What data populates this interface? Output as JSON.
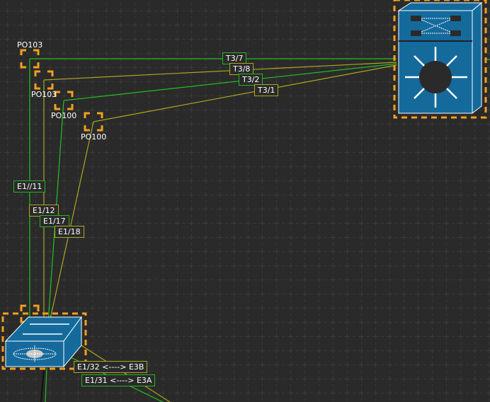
{
  "links": [
    {
      "name": "T3/7",
      "color": "#22c022"
    },
    {
      "name": "T3/8",
      "color": "#a8a820"
    },
    {
      "name": "T3/2",
      "color": "#22c022"
    },
    {
      "name": "T3/1",
      "color": "#a8a820"
    },
    {
      "name": "E1//11",
      "color": "#22c022"
    },
    {
      "name": "E1/12",
      "color": "#a8a820"
    },
    {
      "name": "E1/17",
      "color": "#22c022"
    },
    {
      "name": "E1/18",
      "color": "#a8a820"
    },
    {
      "name": "E1/32 <----> E3B",
      "color": "#a8a820"
    },
    {
      "name": "E1/31 <----> E3A",
      "color": "#22c022"
    }
  ],
  "port_channels": [
    "PO103",
    "PO103",
    "PO100",
    "PO100"
  ],
  "selection_color": "#f0a020",
  "device_color": "#156a9c"
}
